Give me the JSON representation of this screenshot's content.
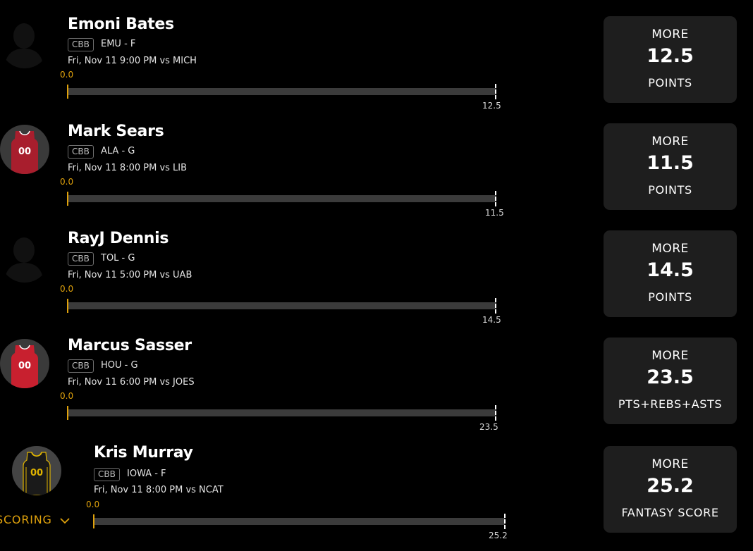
{
  "accent_color": "#e0a20c",
  "scoring_toggle": {
    "label": "SCORING",
    "icon": "chevron-down-icon"
  },
  "players": [
    {
      "name": "Emoni Bates",
      "league": "CBB",
      "team_pos": "EMU - F",
      "game_time": "Fri, Nov 11 9:00 PM  vs MICH",
      "start_value": "0.0",
      "target_value": "12.5",
      "avatar": "silhouette-icon",
      "card": {
        "direction": "MORE",
        "line": "12.5",
        "stat": "POINTS"
      }
    },
    {
      "name": "Mark Sears",
      "league": "CBB",
      "team_pos": "ALA - G",
      "game_time": "Fri, Nov 11 8:00 PM  vs LIB",
      "start_value": "0.0",
      "target_value": "11.5",
      "avatar": "jersey-icon",
      "jersey_color": "#a81e2d",
      "jersey_number": "00",
      "card": {
        "direction": "MORE",
        "line": "11.5",
        "stat": "POINTS"
      }
    },
    {
      "name": "RayJ Dennis",
      "league": "CBB",
      "team_pos": "TOL - G",
      "game_time": "Fri, Nov 11 5:00 PM  vs UAB",
      "start_value": "0.0",
      "target_value": "14.5",
      "avatar": "silhouette-icon",
      "card": {
        "direction": "MORE",
        "line": "14.5",
        "stat": "POINTS"
      }
    },
    {
      "name": "Marcus Sasser",
      "league": "CBB",
      "team_pos": "HOU - G",
      "game_time": "Fri, Nov 11 6:00 PM  vs JOES",
      "start_value": "0.0",
      "target_value": "23.5",
      "avatar": "jersey-icon",
      "jersey_color": "#c8202f",
      "jersey_number": "00",
      "card": {
        "direction": "MORE",
        "line": "23.5",
        "stat": "PTS+REBS+ASTS"
      }
    },
    {
      "name": "Kris Murray",
      "league": "CBB",
      "team_pos": "IOWA - F",
      "game_time": "Fri, Nov 11 8:00 PM  vs NCAT",
      "start_value": "0.0",
      "target_value": "25.2",
      "avatar": "jersey-icon",
      "jersey_color": "#1a1a1a",
      "jersey_trim": "#e0b400",
      "jersey_number": "00",
      "card": {
        "direction": "MORE",
        "line": "25.2",
        "stat": "FANTASY SCORE"
      }
    }
  ]
}
